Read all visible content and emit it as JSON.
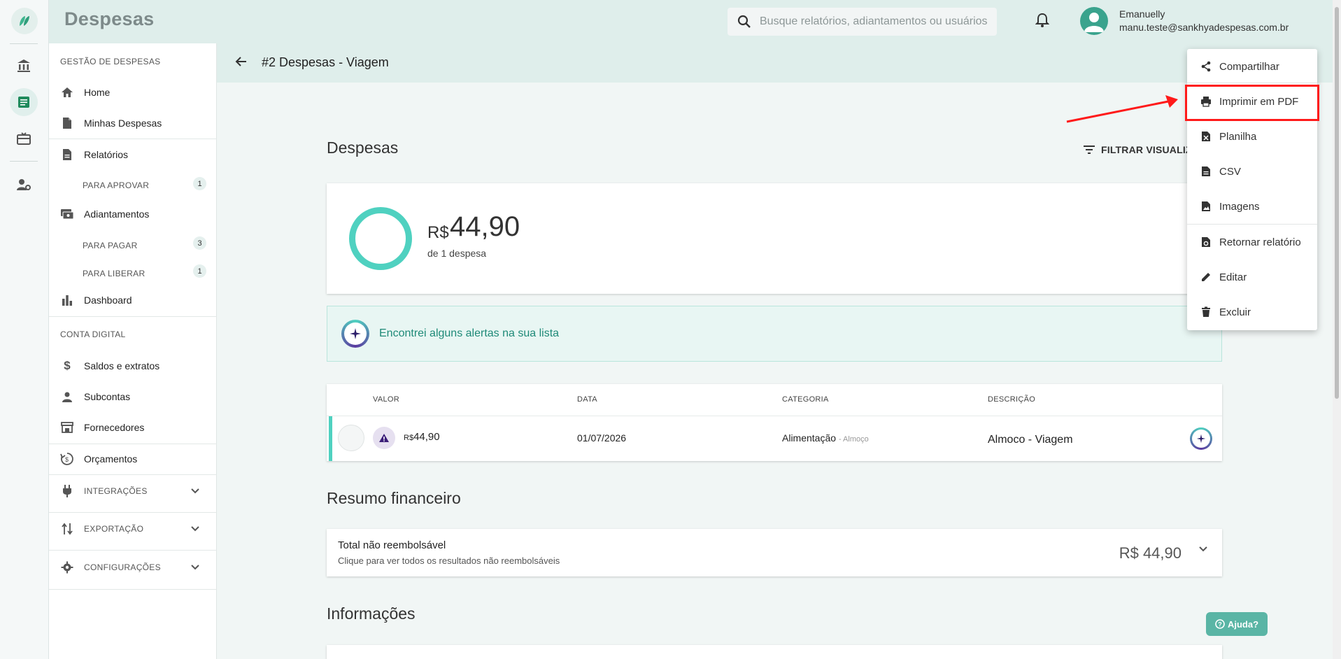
{
  "header": {
    "title": "Despesas",
    "search_placeholder": "Busque relatórios, adiantamentos ou usuários",
    "user_name": "Emanuelly",
    "user_email": "manu.teste@sankhyadespesas.com.br"
  },
  "sidebar": {
    "section_expenses": "GESTÃO DE DESPESAS",
    "home": "Home",
    "my_expenses": "Minhas Despesas",
    "reports": "Relatórios",
    "to_approve": "PARA APROVAR",
    "to_approve_count": "1",
    "advances": "Adiantamentos",
    "to_pay": "PARA PAGAR",
    "to_pay_count": "3",
    "to_release": "PARA LIBERAR",
    "to_release_count": "1",
    "dashboard": "Dashboard",
    "section_digital": "CONTA DIGITAL",
    "balances": "Saldos e extratos",
    "subaccounts": "Subcontas",
    "suppliers": "Fornecedores",
    "budgets": "Orçamentos",
    "integrations": "INTEGRAÇÕES",
    "export": "EXPORTAÇÃO",
    "settings": "CONFIGURAÇÕES"
  },
  "page": {
    "title": "#2 Despesas - Viagem",
    "section_expenses": "Despesas",
    "filter_label": "FILTRAR VISUALIZAÇÃO",
    "total_currency": "R$",
    "total_value": "44,90",
    "total_sub": "de 1 despesa",
    "alert_text": "Encontrei alguns alertas na sua lista",
    "table": {
      "headers": [
        "VALOR",
        "DATA",
        "CATEGORIA",
        "DESCRIÇÃO"
      ],
      "row": {
        "currency": "R$",
        "value": "44,90",
        "date": "01/07/2026",
        "category": "Alimentação",
        "subcategory": "- Almoço",
        "description": "Almoco - Viagem"
      }
    },
    "section_financial": "Resumo financeiro",
    "fin_title": "Total não reembolsável",
    "fin_sub": "Clique para ver todos os resultados não reembolsáveis",
    "fin_amount": "R$ 44,90",
    "section_info": "Informações"
  },
  "menu": {
    "share": "Compartilhar",
    "print_pdf": "Imprimir em PDF",
    "spreadsheet": "Planilha",
    "csv": "CSV",
    "images": "Imagens",
    "return_report": "Retornar relatório",
    "edit": "Editar",
    "delete": "Excluir"
  },
  "help_label": "Ajuda?",
  "colors": {
    "accent": "#4fd1c0",
    "header_bg": "#dfeeeb",
    "highlight": "#ff1a1a",
    "alert_text": "#1f8a78"
  }
}
